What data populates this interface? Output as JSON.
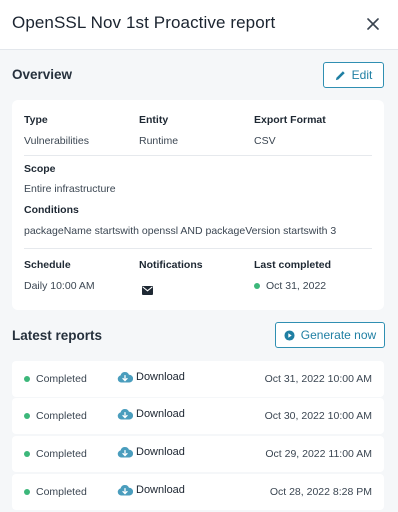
{
  "header": {
    "title": "OpenSSL Nov 1st Proactive report"
  },
  "overview": {
    "title": "Overview",
    "edit_label": "Edit",
    "type_label": "Type",
    "type_value": "Vulnerabilities",
    "entity_label": "Entity",
    "entity_value": "Runtime",
    "format_label": "Export Format",
    "format_value": "CSV",
    "scope_label": "Scope",
    "scope_value": "Entire infrastructure",
    "conditions_label": "Conditions",
    "conditions_value": "packageName startswith openssl AND packageVersion startswith 3",
    "schedule_label": "Schedule",
    "schedule_value": "Daily  10:00 AM",
    "notifications_label": "Notifications",
    "notifications_icon": "mail-icon",
    "last_completed_label": "Last completed",
    "last_completed_value": "Oct 31, 2022"
  },
  "latest": {
    "title": "Latest reports",
    "generate_label": "Generate now",
    "reports": [
      {
        "status": "Completed",
        "action": "Download",
        "date": "Oct 31, 2022 10:00 AM"
      },
      {
        "status": "Completed",
        "action": "Download",
        "date": "Oct 30, 2022 10:00 AM"
      },
      {
        "status": "Completed",
        "action": "Download",
        "date": "Oct 29, 2022 11:00 AM"
      },
      {
        "status": "Completed",
        "action": "Download",
        "date": "Oct 28, 2022 8:28 PM"
      }
    ]
  },
  "colors": {
    "accent": "#2f8fb2",
    "status_green": "#3cb77a",
    "background": "#f5f7f9"
  }
}
